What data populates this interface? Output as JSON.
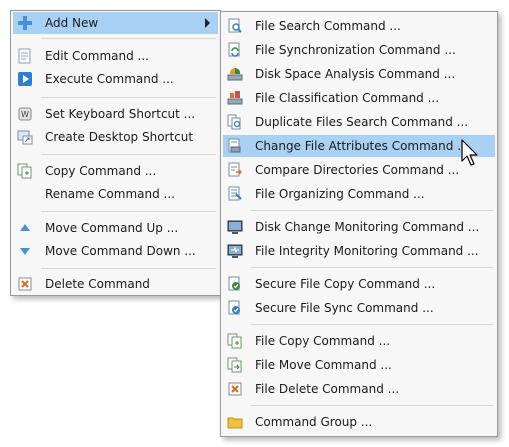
{
  "main_menu": {
    "add_new": "Add New",
    "edit_command": "Edit Command ...",
    "execute_command": "Execute Command ...",
    "set_keyboard_shortcut": "Set Keyboard Shortcut ...",
    "create_desktop_shortcut": "Create Desktop Shortcut",
    "copy_command": "Copy Command ...",
    "rename_command": "Rename Command ...",
    "move_command_up": "Move Command Up ...",
    "move_command_down": "Move Command Down ...",
    "delete_command": "Delete Command"
  },
  "add_new_submenu": {
    "file_search": "File Search Command ...",
    "file_synchronization": "File Synchronization Command ...",
    "disk_space_analysis": "Disk Space Analysis Command ...",
    "file_classification": "File Classification Command ...",
    "duplicate_files_search": "Duplicate Files Search Command ...",
    "change_file_attributes": "Change File Attributes Command ...",
    "compare_directories": "Compare Directories Command ...",
    "file_organizing": "File Organizing Command ...",
    "disk_change_monitoring": "Disk Change Monitoring Command ...",
    "file_integrity_monitoring": "File Integrity Monitoring Command ...",
    "secure_file_copy": "Secure File Copy Command ...",
    "secure_file_sync": "Secure File Sync Command ...",
    "file_copy": "File Copy Command ...",
    "file_move": "File Move Command ...",
    "file_delete": "File Delete Command ...",
    "command_group": "Command Group ..."
  },
  "highlighted_items": [
    "add_new",
    "change_file_attributes"
  ],
  "colors": {
    "highlight": "#a9d1f4",
    "menu_background": "#f7f7f7",
    "border": "#9a9a9a"
  }
}
